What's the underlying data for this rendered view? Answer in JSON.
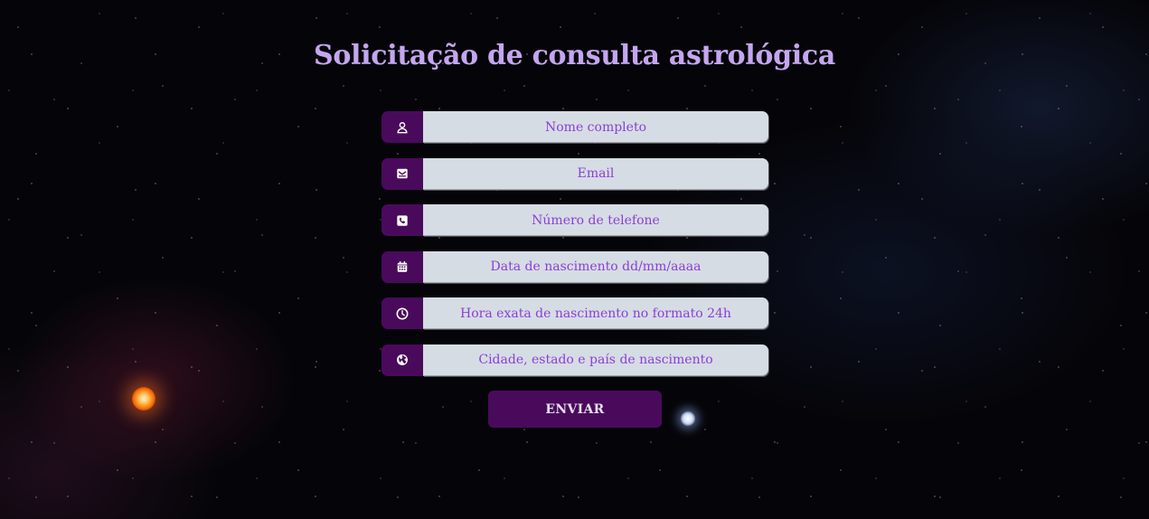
{
  "page": {
    "title": "Solicitação de consulta astrológica"
  },
  "form": {
    "fields": [
      {
        "icon": "user-icon",
        "placeholder": "Nome completo"
      },
      {
        "icon": "envelope-icon",
        "placeholder": "Email"
      },
      {
        "icon": "phone-icon",
        "placeholder": "Número de telefone"
      },
      {
        "icon": "calendar-icon",
        "placeholder": "Data de nascimento dd/mm/aaaa"
      },
      {
        "icon": "clock-icon",
        "placeholder": "Hora exata de nascimento no formato 24h"
      },
      {
        "icon": "globe-icon",
        "placeholder": "Cidade, estado e país de nascimento"
      }
    ],
    "submit_label": "ENVIAR"
  },
  "colors": {
    "title": "#c4a6f0",
    "accent": "#4a0a5c",
    "input_bg": "#d6dce4",
    "placeholder": "#8a3fd6"
  }
}
